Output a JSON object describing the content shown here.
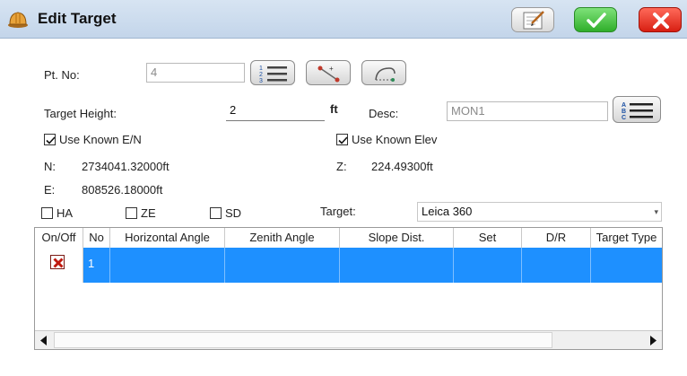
{
  "window": {
    "title": "Edit Target"
  },
  "toolbar": {
    "note_icon": "note-pad-icon",
    "ok_icon": "checkmark-icon",
    "close_icon": "x-close-icon"
  },
  "form": {
    "pt_no_label": "Pt. No:",
    "pt_no_value": "4",
    "target_height_label": "Target Height:",
    "target_height_value": "2",
    "target_height_unit": "ft",
    "desc_label": "Desc:",
    "desc_value": "MON1",
    "use_known_en_label": "Use Known E/N",
    "use_known_en_checked": true,
    "use_known_elev_label": "Use Known Elev",
    "use_known_elev_checked": true,
    "n_label": "N:",
    "n_value": "2734041.32000ft",
    "e_label": "E:",
    "e_value": "808526.18000ft",
    "z_label": "Z:",
    "z_value": "224.49300ft",
    "ha_label": "HA",
    "ze_label": "ZE",
    "sd_label": "SD",
    "target_label": "Target:",
    "target_value": "Leica 360"
  },
  "grid": {
    "columns": [
      "On/Off",
      "No",
      "Horizontal Angle",
      "Zenith Angle",
      "Slope Dist.",
      "Set",
      "D/R",
      "Target Type"
    ],
    "rows": [
      {
        "on_off": "off",
        "no": "1",
        "horizontal_angle": "",
        "zenith_angle": "",
        "slope_dist": "",
        "set": "",
        "dr": "",
        "target_type": ""
      }
    ]
  },
  "colors": {
    "selection": "#1e90ff",
    "titlebar": "#c9dbee",
    "ok_green": "#3bbf35",
    "close_red": "#e0281a"
  }
}
